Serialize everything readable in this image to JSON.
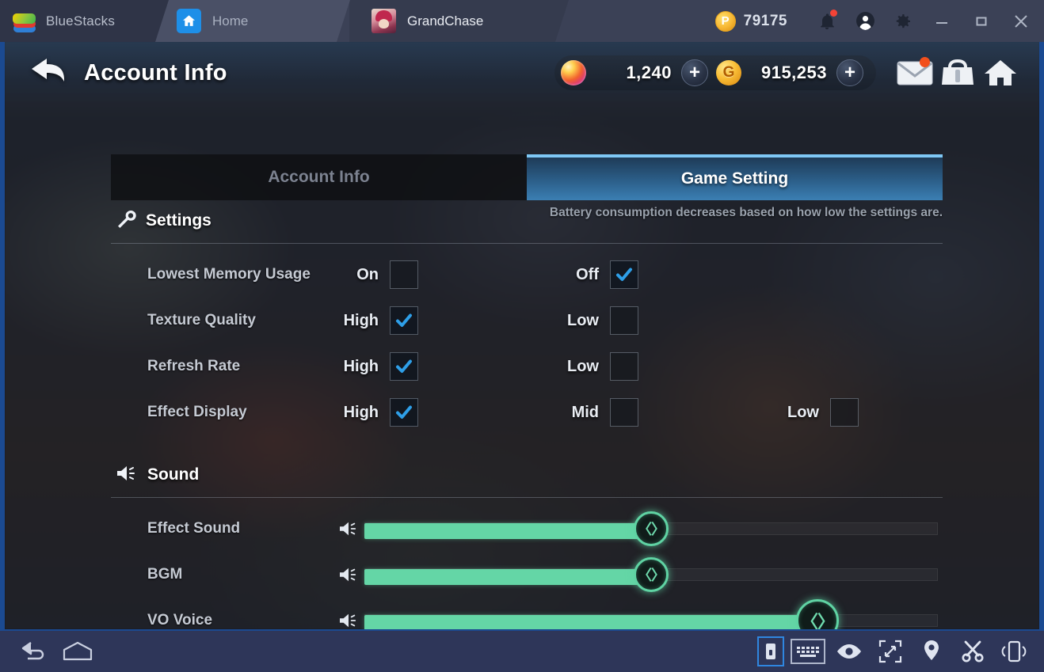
{
  "window": {
    "brand": "BlueStacks",
    "tabs": [
      {
        "label": "Home",
        "icon": "home-icon",
        "active": false
      },
      {
        "label": "GrandChase",
        "icon": "grandchase-avatar",
        "active": true
      }
    ],
    "points_value": "79175",
    "points_icon": "P",
    "controls": {
      "notifications": "bell-icon",
      "account": "account-icon",
      "settings": "gear-icon",
      "minimize": "minimize-icon",
      "maximize": "maximize-icon",
      "close": "close-icon"
    }
  },
  "game_header": {
    "back_label": "back-arrow",
    "title": "Account Info",
    "currencies": [
      {
        "name": "gem",
        "value": "1,240",
        "add_label": "+"
      },
      {
        "name": "gold",
        "value": "915,253",
        "add_label": "+"
      }
    ],
    "icons": [
      {
        "name": "mail-icon",
        "badge": true
      },
      {
        "name": "inventory-icon",
        "badge": false
      },
      {
        "name": "home-icon",
        "badge": false
      }
    ]
  },
  "tabs": [
    {
      "label": "Account Info",
      "active": false
    },
    {
      "label": "Game Setting",
      "active": true
    }
  ],
  "settings_section": {
    "title": "Settings",
    "icon": "wrench-icon",
    "note": "Battery consumption decreases based on how low the settings are.",
    "rows": [
      {
        "label": "Lowest Memory Usage",
        "options": [
          {
            "label": "On",
            "checked": false
          },
          {
            "label": "Off",
            "checked": true
          }
        ]
      },
      {
        "label": "Texture Quality",
        "options": [
          {
            "label": "High",
            "checked": true
          },
          {
            "label": "Low",
            "checked": false
          }
        ]
      },
      {
        "label": "Refresh Rate",
        "options": [
          {
            "label": "High",
            "checked": true
          },
          {
            "label": "Low",
            "checked": false
          }
        ]
      },
      {
        "label": "Effect Display",
        "options": [
          {
            "label": "High",
            "checked": true
          },
          {
            "label": "Mid",
            "checked": false
          },
          {
            "label": "Low",
            "checked": false
          }
        ]
      }
    ]
  },
  "sound_section": {
    "title": "Sound",
    "icon": "speaker-icon",
    "sliders": [
      {
        "label": "Effect Sound",
        "value": 50,
        "icon": "speaker-icon"
      },
      {
        "label": "BGM",
        "value": 50,
        "icon": "speaker-icon"
      },
      {
        "label": "VO Voice",
        "value": 79,
        "icon": "speaker-icon"
      }
    ]
  },
  "bottom_toolbar": {
    "left": [
      {
        "name": "back-icon"
      },
      {
        "name": "home-icon"
      }
    ],
    "right": [
      {
        "name": "game-controls-icon",
        "highlighted": true
      },
      {
        "name": "keyboard-icon",
        "highlighted": false
      },
      {
        "name": "eye-icon",
        "highlighted": false
      },
      {
        "name": "fullscreen-icon",
        "highlighted": false
      },
      {
        "name": "location-pin-icon",
        "highlighted": false
      },
      {
        "name": "scissors-icon",
        "highlighted": false
      },
      {
        "name": "shake-phone-icon",
        "highlighted": false
      }
    ]
  },
  "colors": {
    "accent_blue": "#2f86e0",
    "slider_green": "#64d6a6",
    "tab_active": "#3b7fb3",
    "checkbox_tick": "#2e9fe8",
    "toolbar_bg": "#2e3659",
    "titlebar_bg": "#3b4156"
  }
}
